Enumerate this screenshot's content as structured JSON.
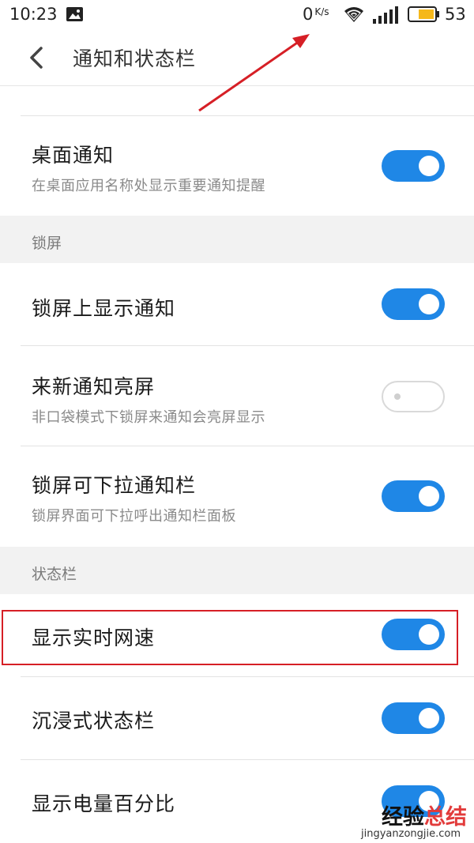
{
  "status_bar": {
    "time": "10:23",
    "net_speed_value": "0",
    "net_speed_unit": "K/s",
    "battery_level": "53",
    "icons": [
      "photo-icon",
      "wifi-icon",
      "signal-icon",
      "battery-icon"
    ]
  },
  "header": {
    "title": "通知和状态栏"
  },
  "settings": {
    "desktop_notification": {
      "title": "桌面通知",
      "subtitle": "在桌面应用名称处显示重要通知提醒",
      "enabled": true
    },
    "lockscreen_section": "锁屏",
    "show_on_lockscreen": {
      "title": "锁屏上显示通知",
      "enabled": true
    },
    "wake_on_notification": {
      "title": "来新通知亮屏",
      "subtitle": "非口袋模式下锁屏来通知会亮屏显示",
      "enabled": false
    },
    "pulldown_on_lockscreen": {
      "title": "锁屏可下拉通知栏",
      "subtitle": "锁屏界面可下拉呼出通知栏面板",
      "enabled": true
    },
    "statusbar_section": "状态栏",
    "realtime_net_speed": {
      "title": "显示实时网速",
      "enabled": true
    },
    "immersive_statusbar": {
      "title": "沉浸式状态栏",
      "enabled": true
    },
    "battery_percentage": {
      "title": "显示电量百分比",
      "enabled": true
    }
  },
  "watermark": {
    "main_black": "经验",
    "main_red": "总结",
    "sub": "jingyanzongjie.com"
  },
  "colors": {
    "toggle_on": "#1f87e6",
    "toggle_off_border": "#d9d9d9",
    "highlight": "#d61f26",
    "section_bg": "#f2f2f2",
    "battery_fill": "#f5b81a"
  }
}
